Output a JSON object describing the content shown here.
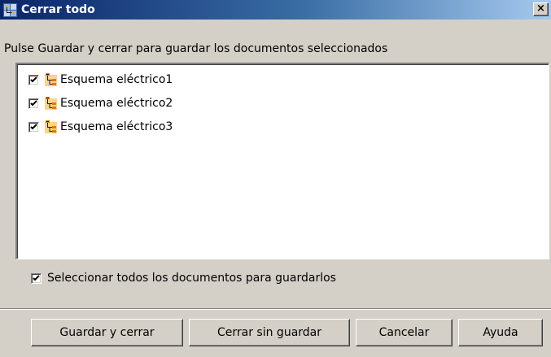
{
  "window": {
    "title": "Cerrar todo",
    "close_label": "×"
  },
  "instruction": "Pulse Guardar y cerrar para guardar los documentos seleccionados",
  "documents": [
    {
      "label": "Esquema eléctrico1",
      "checked": true
    },
    {
      "label": "Esquema eléctrico2",
      "checked": true
    },
    {
      "label": "Esquema eléctrico3",
      "checked": true
    }
  ],
  "select_all": {
    "label": "Seleccionar todos los documentos para guardarlos",
    "checked": true
  },
  "buttons": {
    "save_close": "Guardar y cerrar",
    "close_no_save": "Cerrar sin guardar",
    "cancel": "Cancelar",
    "help": "Ayuda"
  },
  "colors": {
    "title_start": "#0a246a",
    "title_end": "#a6caf0",
    "face": "#d4d0c8",
    "icon_orange": "#f5a623"
  },
  "icons": {
    "title": "multi-document-icon",
    "document": "schematic-document-icon",
    "check": "checkmark-icon"
  }
}
